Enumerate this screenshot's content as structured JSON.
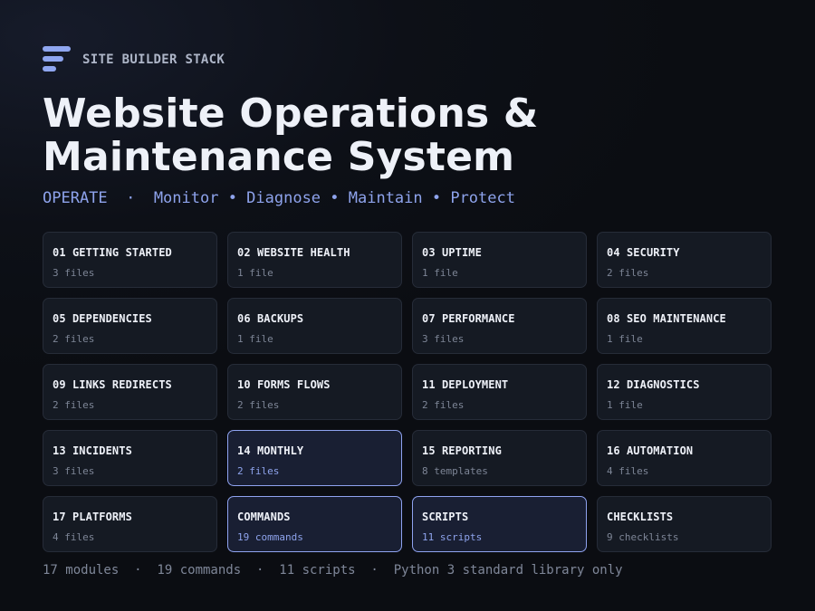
{
  "brand": {
    "name": "SITE BUILDER STACK",
    "icon": "stack-bars-icon",
    "color": "#8fa6f0"
  },
  "header": {
    "title_line1": "Website Operations &",
    "title_line2": "Maintenance System",
    "tagline": "OPERATE  ·  Monitor • Diagnose • Maintain • Protect"
  },
  "colors": {
    "background": "#0b0d12",
    "card": "#151a23",
    "card_highlight": "#191f33",
    "accent": "#8fa3f0",
    "muted": "#7d8596"
  },
  "modules": [
    {
      "title": "01 GETTING STARTED",
      "count": "3 files",
      "highlighted": false
    },
    {
      "title": "02 WEBSITE HEALTH",
      "count": "1 file",
      "highlighted": false
    },
    {
      "title": "03 UPTIME",
      "count": "1 file",
      "highlighted": false
    },
    {
      "title": "04 SECURITY",
      "count": "2 files",
      "highlighted": false
    },
    {
      "title": "05 DEPENDENCIES",
      "count": "2 files",
      "highlighted": false
    },
    {
      "title": "06 BACKUPS",
      "count": "1 file",
      "highlighted": false
    },
    {
      "title": "07 PERFORMANCE",
      "count": "3 files",
      "highlighted": false
    },
    {
      "title": "08 SEO MAINTENANCE",
      "count": "1 file",
      "highlighted": false
    },
    {
      "title": "09 LINKS REDIRECTS",
      "count": "2 files",
      "highlighted": false
    },
    {
      "title": "10 FORMS FLOWS",
      "count": "2 files",
      "highlighted": false
    },
    {
      "title": "11 DEPLOYMENT",
      "count": "2 files",
      "highlighted": false
    },
    {
      "title": "12 DIAGNOSTICS",
      "count": "1 file",
      "highlighted": false
    },
    {
      "title": "13 INCIDENTS",
      "count": "3 files",
      "highlighted": false
    },
    {
      "title": "14 MONTHLY",
      "count": "2 files",
      "highlighted": true
    },
    {
      "title": "15 REPORTING",
      "count": "8 templates",
      "highlighted": false
    },
    {
      "title": "16 AUTOMATION",
      "count": "4 files",
      "highlighted": false
    },
    {
      "title": "17 PLATFORMS",
      "count": "4 files",
      "highlighted": false
    },
    {
      "title": "COMMANDS",
      "count": "19 commands",
      "highlighted": true
    },
    {
      "title": "SCRIPTS",
      "count": "11 scripts",
      "highlighted": true
    },
    {
      "title": "CHECKLISTS",
      "count": "9 checklists",
      "highlighted": false
    }
  ],
  "footer": {
    "text": "17 modules  ·  19 commands  ·  11 scripts  ·  Python 3 standard library only"
  }
}
